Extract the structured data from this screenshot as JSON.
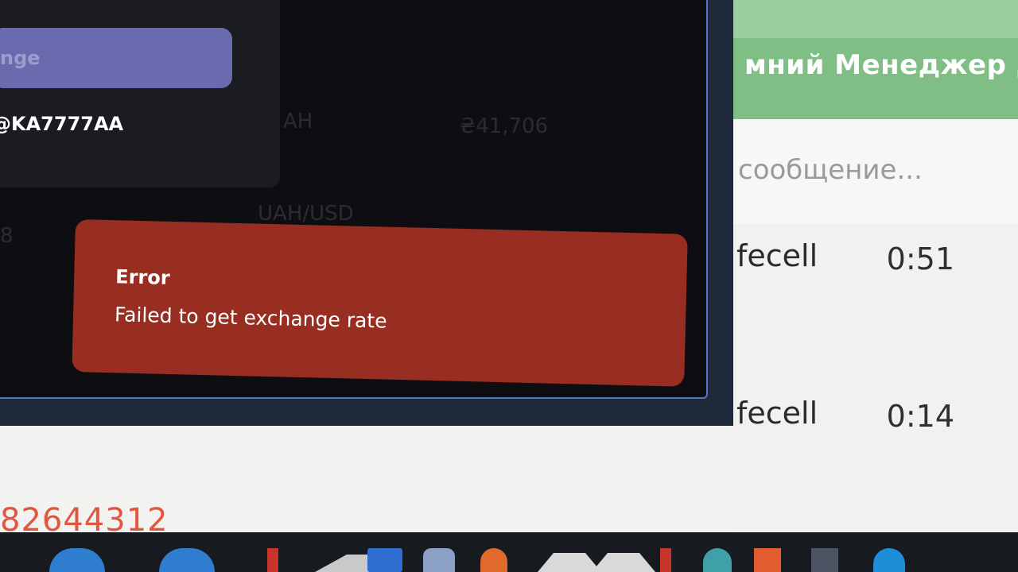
{
  "background_app": {
    "header_title": "мний Менеджер д",
    "search_placeholder": "сообщение...",
    "chats": [
      {
        "name": "fecell",
        "time": "0:51"
      },
      {
        "name": "fecell",
        "time": "0:14"
      }
    ],
    "number": "82644312"
  },
  "app": {
    "exchange_button_label": "nge",
    "wallet_address": "KA7777AA",
    "currency_label": "AH",
    "balance_value": "₴41,706",
    "pair_label": "UAH/USD",
    "side_value": "8"
  },
  "toast": {
    "title": "Error",
    "message": "Failed to get exchange rate"
  },
  "taskbar": {
    "icons": [
      "edge-icon",
      "edge-icon",
      "app-icon",
      "arrow-icon",
      "mail-icon",
      "app-icon",
      "app-icon",
      "app-icon",
      "vlc-icon",
      "app-icon",
      "app-icon",
      "app-icon",
      "app-icon",
      "app-icon"
    ]
  }
}
